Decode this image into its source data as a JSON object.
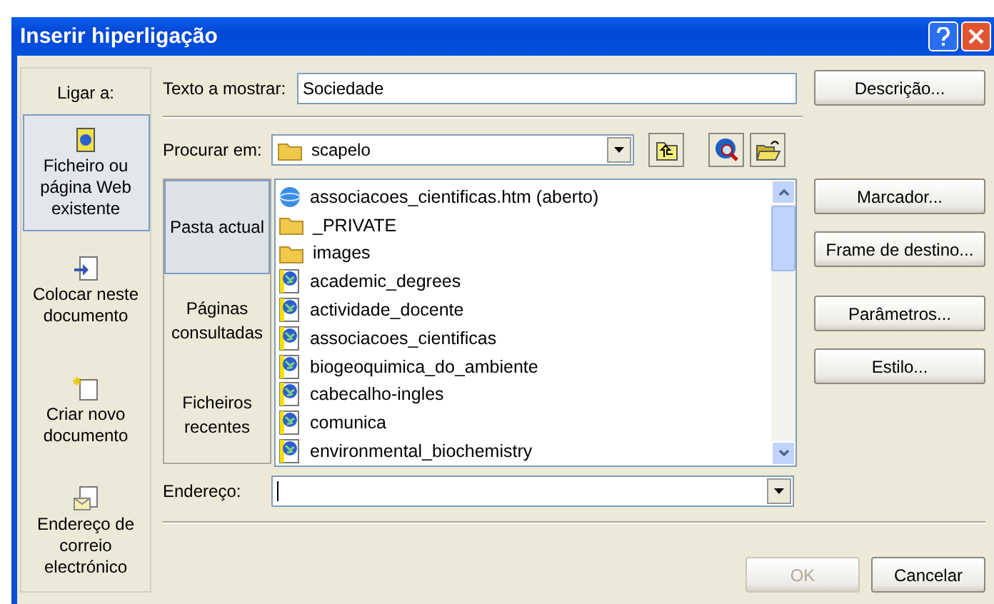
{
  "window": {
    "title": "Inserir hiperligação"
  },
  "link_to": {
    "label": "Ligar a:",
    "items": [
      {
        "label": "Ficheiro ou página Web existente",
        "kind": "web",
        "selected": true
      },
      {
        "label": "Colocar neste documento",
        "kind": "place",
        "selected": false
      },
      {
        "label": "Criar novo documento",
        "kind": "new",
        "selected": false
      },
      {
        "label": "Endereço de correio electrónico",
        "kind": "mail",
        "selected": false
      }
    ]
  },
  "text_to_display": {
    "label": "Texto a mostrar:",
    "value": "Sociedade"
  },
  "description_button": "Descrição...",
  "look_in": {
    "label": "Procurar em:",
    "value": "scapelo"
  },
  "places": [
    {
      "label": "Pasta actual",
      "selected": true
    },
    {
      "label": "Páginas consultadas",
      "selected": false
    },
    {
      "label": "Ficheiros recentes",
      "selected": false
    }
  ],
  "files": [
    {
      "name": "associacoes_cientificas.htm (aberto)",
      "kind": "ie"
    },
    {
      "name": "_PRIVATE",
      "kind": "folder"
    },
    {
      "name": "images",
      "kind": "folder"
    },
    {
      "name": "academic_degrees",
      "kind": "page"
    },
    {
      "name": "actividade_docente",
      "kind": "page"
    },
    {
      "name": "associacoes_cientificas",
      "kind": "page"
    },
    {
      "name": "biogeoquimica_do_ambiente",
      "kind": "page"
    },
    {
      "name": "cabecalho-ingles",
      "kind": "page"
    },
    {
      "name": "comunica",
      "kind": "page"
    },
    {
      "name": "environmental_biochemistry",
      "kind": "page"
    }
  ],
  "side_buttons": [
    "Marcador...",
    "Frame de destino...",
    "Parâmetros...",
    "Estilo..."
  ],
  "address": {
    "label": "Endereço:"
  },
  "footer_buttons": [
    {
      "label": "OK",
      "disabled": true
    },
    {
      "label": "Cancelar",
      "disabled": false
    }
  ]
}
